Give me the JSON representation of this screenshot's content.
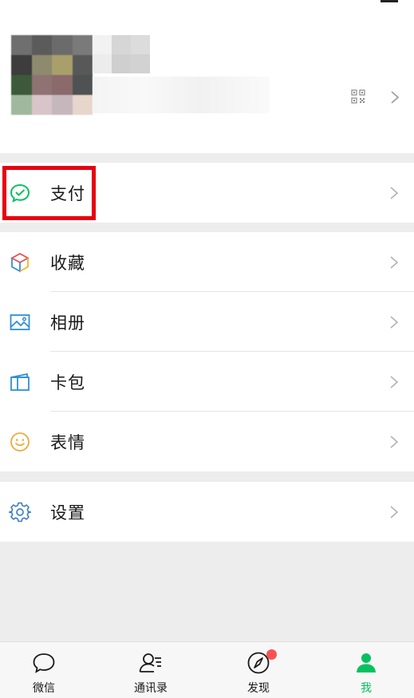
{
  "profile": {
    "avatar_icon": "blurred-avatar",
    "qr_icon": "qr-code-icon",
    "arrow_icon": "chevron-right-icon"
  },
  "menu": {
    "pay": {
      "label": "支付",
      "icon": "wechat-pay-icon"
    },
    "favorites": {
      "label": "收藏",
      "icon": "cube-icon"
    },
    "album": {
      "label": "相册",
      "icon": "image-icon"
    },
    "cards": {
      "label": "卡包",
      "icon": "wallet-icon"
    },
    "stickers": {
      "label": "表情",
      "icon": "smiley-icon"
    },
    "settings": {
      "label": "设置",
      "icon": "gear-icon"
    }
  },
  "tabbar": {
    "chats": "微信",
    "contacts": "通讯录",
    "discover": "发现",
    "me": "我"
  },
  "colors": {
    "accent": "#07c160",
    "highlight": "#e60012",
    "badge": "#fa5151",
    "pay_green": "#07c160",
    "settings_blue": "#3e7fc1"
  }
}
